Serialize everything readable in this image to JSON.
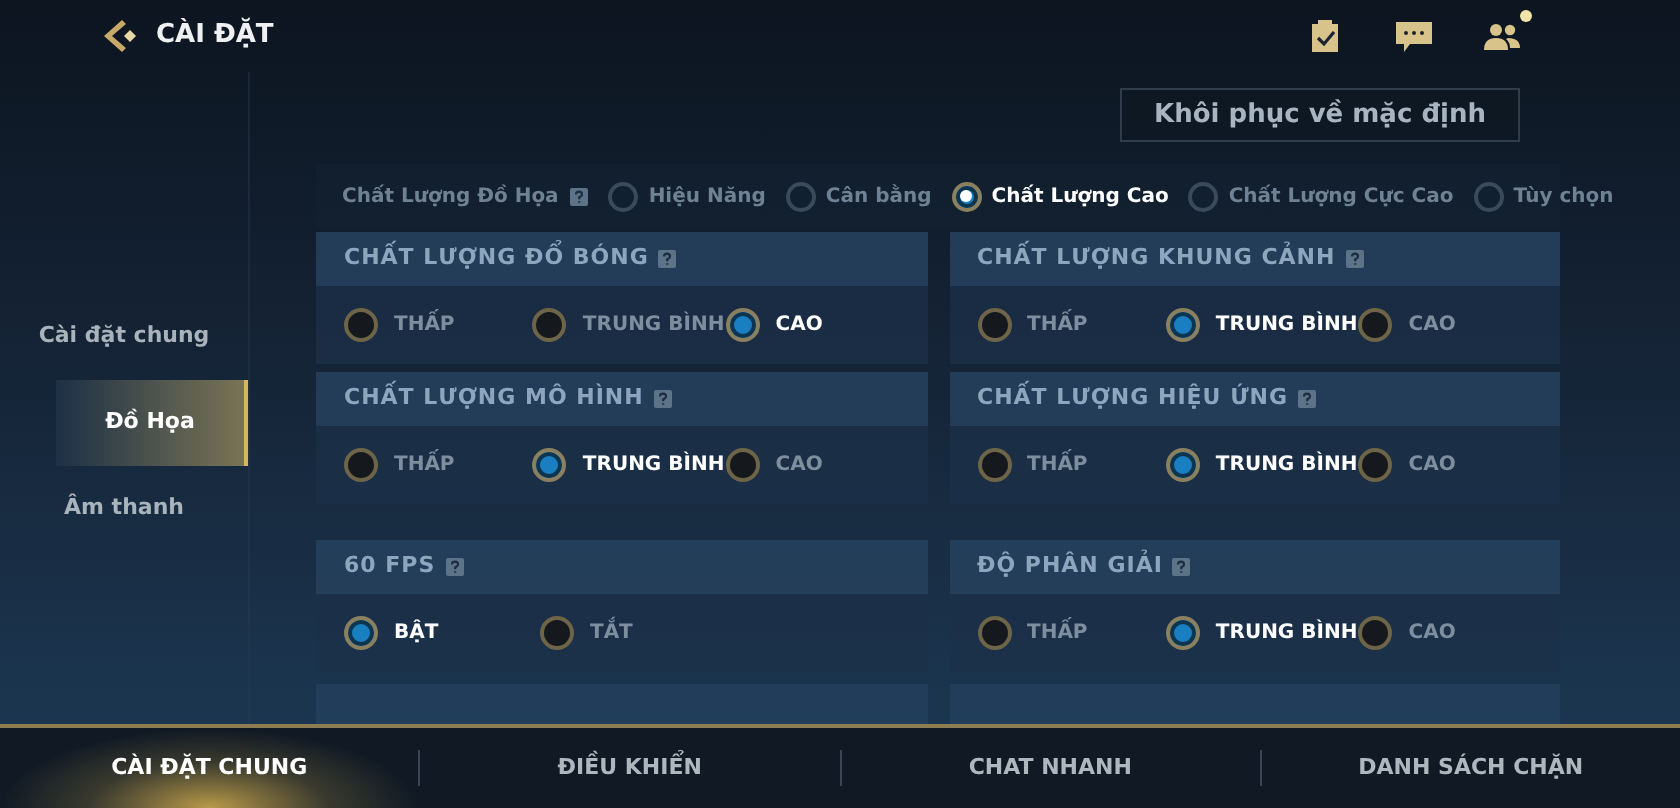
{
  "header": {
    "title": "CÀI ĐẶT"
  },
  "reset_button": "Khôi phục về mặc định",
  "preset": {
    "label": "Chất Lượng Đồ Họa",
    "options": [
      {
        "label": "Hiệu Năng",
        "selected": false
      },
      {
        "label": "Cân bằng",
        "selected": false
      },
      {
        "label": "Chất Lượng Cao",
        "selected": true
      },
      {
        "label": "Chất Lượng Cực Cao",
        "selected": false
      },
      {
        "label": "Tùy chọn",
        "selected": false
      }
    ]
  },
  "sidebar": {
    "items": [
      {
        "label": "Cài đặt chung",
        "selected": false
      },
      {
        "label": "Đồ Họa",
        "selected": true
      },
      {
        "label": "Âm thanh",
        "selected": false
      }
    ]
  },
  "settings": [
    {
      "title": "CHẤT LƯỢNG ĐỔ BÓNG",
      "options": [
        {
          "label": "THẤP",
          "selected": false
        },
        {
          "label": "TRUNG BÌNH",
          "selected": false
        },
        {
          "label": "CAO",
          "selected": true
        }
      ]
    },
    {
      "title": "CHẤT LƯỢNG KHUNG CẢNH",
      "options": [
        {
          "label": "THẤP",
          "selected": false
        },
        {
          "label": "TRUNG BÌNH",
          "selected": true
        },
        {
          "label": "CAO",
          "selected": false
        }
      ]
    },
    {
      "title": "CHẤT LƯỢNG MÔ HÌNH",
      "options": [
        {
          "label": "THẤP",
          "selected": false
        },
        {
          "label": "TRUNG BÌNH",
          "selected": true
        },
        {
          "label": "CAO",
          "selected": false
        }
      ]
    },
    {
      "title": "CHẤT LƯỢNG HIỆU ỨNG",
      "options": [
        {
          "label": "THẤP",
          "selected": false
        },
        {
          "label": "TRUNG BÌNH",
          "selected": true
        },
        {
          "label": "CAO",
          "selected": false
        }
      ]
    },
    {
      "title": "60 FPS",
      "options": [
        {
          "label": "BẬT",
          "selected": true
        },
        {
          "label": "TẮT",
          "selected": false
        }
      ]
    },
    {
      "title": "ĐỘ PHÂN GIẢI",
      "options": [
        {
          "label": "THẤP",
          "selected": false
        },
        {
          "label": "TRUNG BÌNH",
          "selected": true
        },
        {
          "label": "CAO",
          "selected": false
        }
      ]
    }
  ],
  "bottom_tabs": [
    {
      "label": "CÀI ĐẶT CHUNG",
      "selected": true
    },
    {
      "label": "ĐIỀU KHIỂN",
      "selected": false
    },
    {
      "label": "CHAT NHANH",
      "selected": false
    },
    {
      "label": "DANH SÁCH CHẶN",
      "selected": false
    }
  ]
}
